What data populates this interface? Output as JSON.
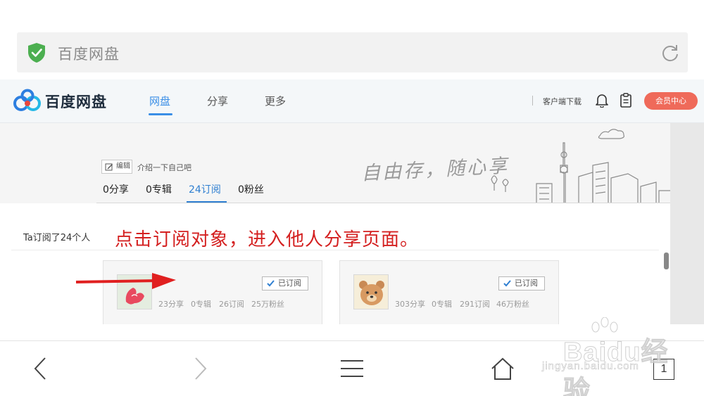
{
  "address_bar": {
    "text": "百度网盘"
  },
  "site": {
    "logo_text": "百度网盘",
    "nav_tabs": [
      "网盘",
      "分享",
      "更多"
    ],
    "client_download": "客户端下载",
    "vip_button": "会员中心"
  },
  "profile": {
    "edit_label": "编辑",
    "intro": "介绍一下自己吧",
    "slogan": "自由存，随心享",
    "stats": [
      "0分享",
      "0专辑",
      "24订阅",
      "0粉丝"
    ]
  },
  "subscriptions": {
    "count_text": "Ta订阅了24个人",
    "annotation": "点击订阅对象，进入他人分享页面。",
    "cards": [
      {
        "button": "已订阅",
        "shares": "23分享",
        "albums": "0专辑",
        "subs": "26订阅",
        "fans": "25万粉丝"
      },
      {
        "button": "已订阅",
        "shares": "303分享",
        "albums": "0专辑",
        "subs": "291订阅",
        "fans": "46万粉丝"
      }
    ]
  },
  "toolbar": {
    "tab_count": "1"
  },
  "watermark": {
    "brand": "Baidu经验",
    "url": "jingyan.baidu.com"
  },
  "colors": {
    "accent": "#3a8ee6",
    "vip": "#ef6a5a",
    "annotation": "#d42020",
    "shield": "#4caf50"
  },
  "icons": [
    "shield-icon",
    "reload-icon",
    "bell-icon",
    "clipboard-icon",
    "edit-icon",
    "check-icon",
    "back-icon",
    "forward-icon",
    "menu-icon",
    "home-icon"
  ]
}
